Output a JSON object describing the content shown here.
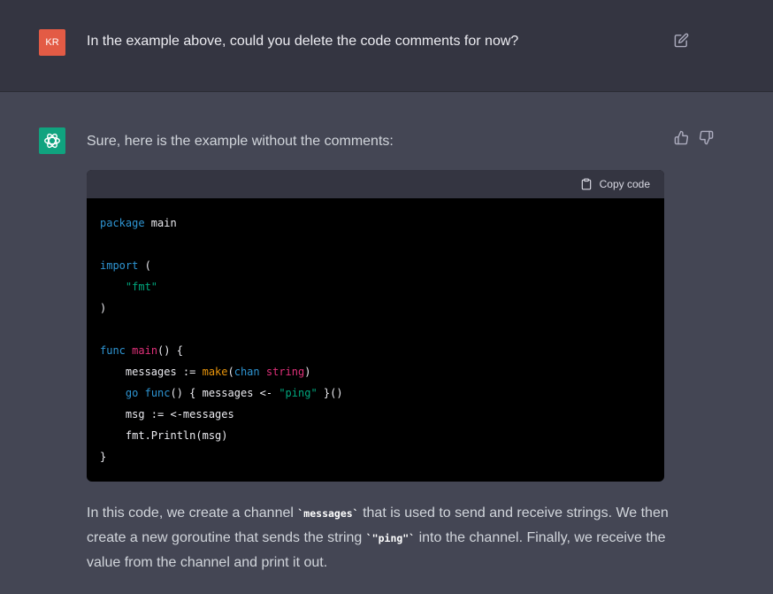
{
  "user": {
    "avatar_initials": "KR",
    "message": "In the example above, could you delete the code comments for now?"
  },
  "assistant": {
    "intro": "Sure, here is the example without the comments:",
    "code_header": {
      "copy_label": "Copy code"
    },
    "code": {
      "l1_kw": "package",
      "l1_rest": " main",
      "l2_kw": "import",
      "l2_rest": " (",
      "l3_str": "\"fmt\"",
      "l4": ")",
      "l5_kw": "func",
      "l5_fn": "main",
      "l5_rest": "() {",
      "l6_a": "    messages := ",
      "l6_make": "make",
      "l6_b": "(",
      "l6_chan": "chan",
      "l6_sp": " ",
      "l6_string": "string",
      "l6_c": ")",
      "l7_go": "go",
      "l7_sp": " ",
      "l7_func": "func",
      "l7_a": "() { messages <- ",
      "l7_str": "\"ping\"",
      "l7_b": " }()",
      "l8": "    msg := <-messages",
      "l9": "    fmt.Println(msg)",
      "l10": "}"
    },
    "explanation": {
      "p1": "In this code, we create a channel ",
      "c1": "`messages`",
      "p2": " that is used to send and receive strings. We then create a new goroutine that sends the string ",
      "c2": "`\"ping\"`",
      "p3": " into the channel. Finally, we receive the value from the channel and print it out."
    }
  },
  "icons": {
    "edit": "edit-icon",
    "thumbs_up": "thumbs-up-icon",
    "thumbs_down": "thumbs-down-icon",
    "clipboard": "clipboard-icon",
    "logo": "chatgpt-logo-icon"
  },
  "colors": {
    "user_bg": "#343541",
    "assistant_bg": "#444654",
    "user_avatar": "#e35b45",
    "bot_avatar": "#10a37f",
    "keyword": "#2e95d3",
    "function": "#df3079",
    "builtin": "#e9950c",
    "string": "#00a67d"
  }
}
